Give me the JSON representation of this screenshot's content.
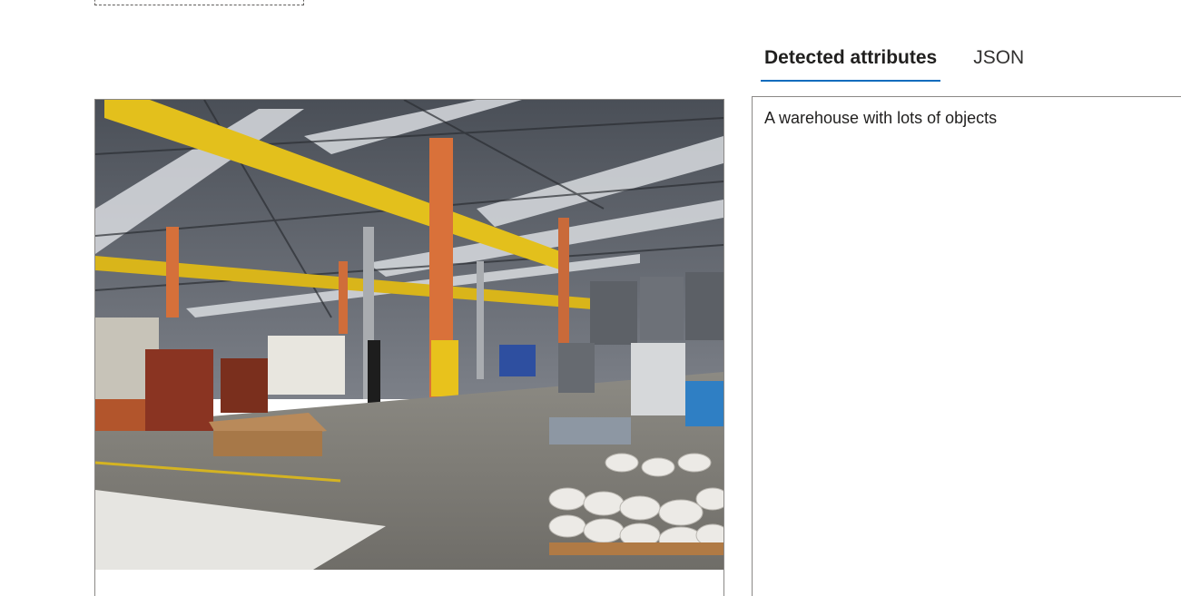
{
  "tabs": [
    {
      "label": "Detected attributes",
      "active": true
    },
    {
      "label": "JSON",
      "active": false
    }
  ],
  "attributes": {
    "caption": "A warehouse with lots of objects"
  },
  "image": {
    "description_icon": "warehouse-photo"
  },
  "colors": {
    "tab_underline": "#0f6cbd",
    "border": "#8a8886"
  }
}
